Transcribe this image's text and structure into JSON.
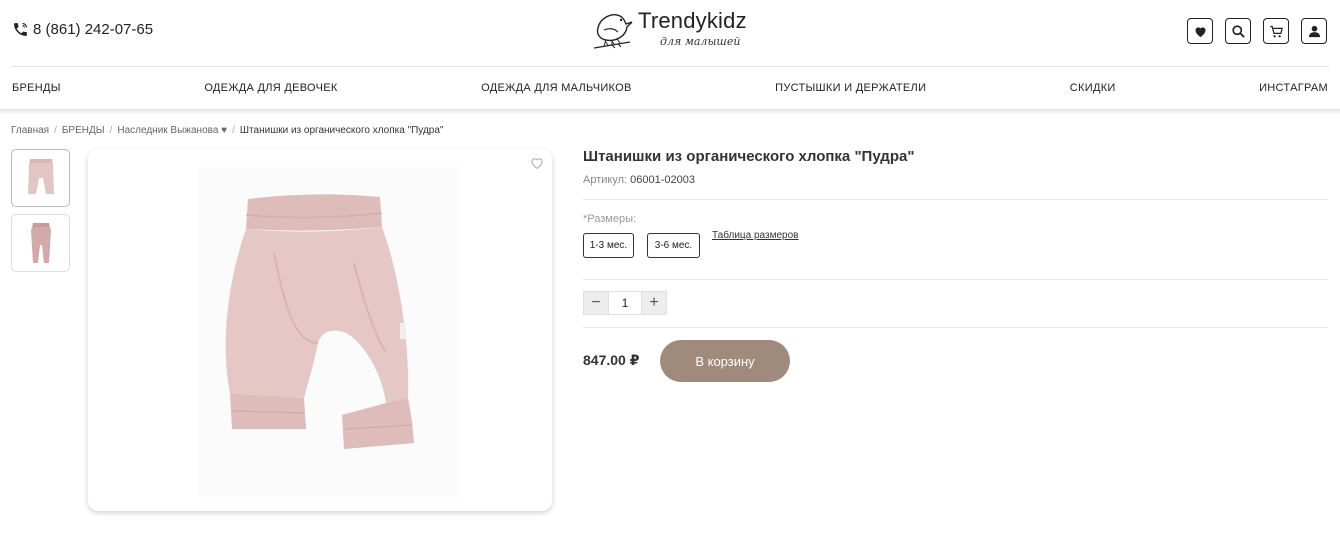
{
  "header": {
    "phone": "8 (861) 242-07-65",
    "logo_title": "Trendykidz",
    "logo_subtitle": "для малышей"
  },
  "nav": {
    "items": [
      "БРЕНДЫ",
      "ОДЕЖДА ДЛЯ ДЕВОЧЕК",
      "ОДЕЖДА ДЛЯ МАЛЬЧИКОВ",
      "ПУСТЫШКИ И ДЕРЖАТЕЛИ",
      "СКИДКИ",
      "ИНСТАГРАМ"
    ]
  },
  "breadcrumb": {
    "items": [
      "Главная",
      "БРЕНДЫ",
      "Наследник Выжанова ♥"
    ],
    "current": "Штанишки из органического хлопка \"Пудра\""
  },
  "product": {
    "title": "Штанишки из органического хлопка \"Пудра\"",
    "sku_label": "Артикул:",
    "sku_value": "06001-02003",
    "sizes_label": "*Размеры:",
    "sizes": [
      "1-3 мес.",
      "3-6 мес."
    ],
    "size_table_link": "Таблица размеров",
    "quantity": "1",
    "qty_minus": "−",
    "qty_plus": "+",
    "price": "847.00 ₽",
    "add_to_cart": "В корзину"
  },
  "colors": {
    "accent": "#a08a7c",
    "product_pink": "#e3c6c3"
  }
}
